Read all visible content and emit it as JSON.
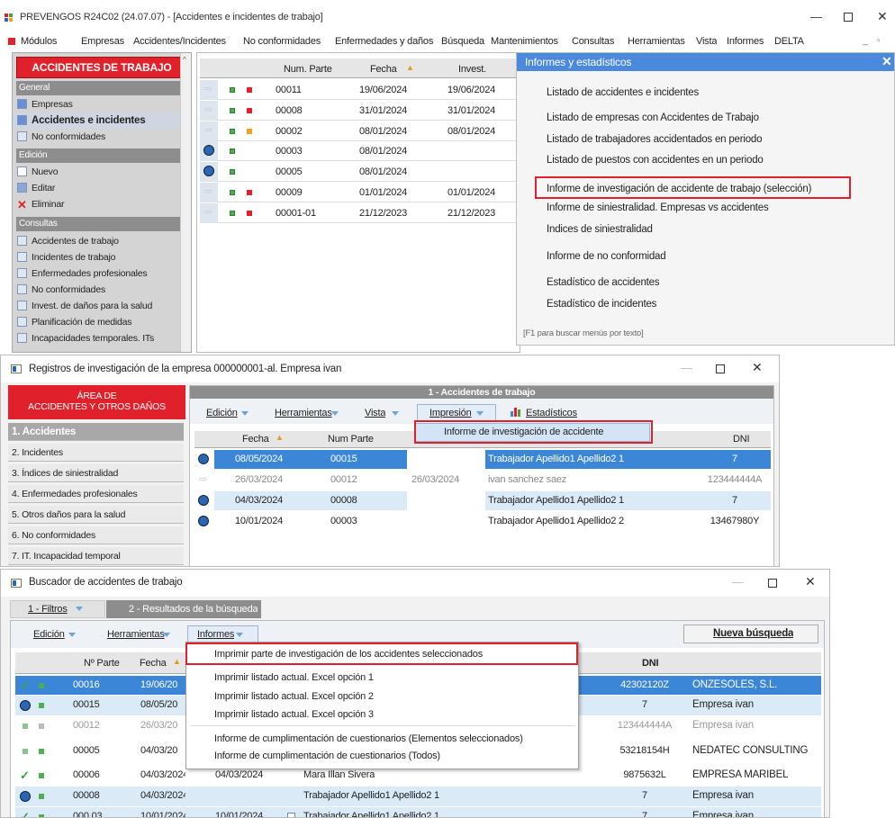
{
  "win1": {
    "title": "PREVENGOS R24C02 (24.07.07) - [Accidentes e incidentes de trabajo]",
    "menu": [
      "Módulos",
      "Empresas",
      "Accidentes/Incidentes",
      "No conformidades",
      "Enfermedades y daños",
      "Búsqueda",
      "Mantenimientos",
      "Consultas",
      "Herramientas",
      "Vista",
      "Informes",
      "DELTA"
    ],
    "sidebar": {
      "header": "ACCIDENTES DE TRABAJO",
      "g1": "General",
      "g1_items": [
        "Empresas",
        "Accidentes e incidentes",
        "No conformidades"
      ],
      "g2": "Edición",
      "g2_items": [
        "Nuevo",
        "Editar",
        "Eliminar"
      ],
      "g3": "Consultas",
      "g3_items": [
        "Accidentes de trabajo",
        "Incidentes de trabajo",
        "Enfermedades profesionales",
        "No conformidades",
        "Invest. de daños para la salud",
        "Planificación de medidas",
        "Incapacidades temporales. ITs"
      ]
    },
    "grid": {
      "headers": [
        "Num. Parte",
        "Fecha",
        "Invest."
      ],
      "rows": [
        {
          "parte": "00011",
          "fecha": "19/06/2024",
          "invest": "19/06/2024"
        },
        {
          "parte": "00008",
          "fecha": "31/01/2024",
          "invest": "31/01/2024"
        },
        {
          "parte": "00002",
          "fecha": "08/01/2024",
          "invest": "08/01/2024"
        },
        {
          "parte": "00003",
          "fecha": "08/01/2024",
          "invest": ""
        },
        {
          "parte": "00005",
          "fecha": "08/01/2024",
          "invest": ""
        },
        {
          "parte": "00009",
          "fecha": "01/01/2024",
          "invest": "01/01/2024"
        },
        {
          "parte": "00001-01",
          "fecha": "21/12/2023",
          "invest": "21/12/2023"
        }
      ]
    },
    "informes": {
      "title": "Informes y estadísticos",
      "items": [
        "Listado de accidentes e incidentes",
        "Listado de empresas con Accidentes de Trabajo",
        "Listado de trabajadores accidentados en periodo",
        "Listado de puestos con accidentes en un periodo",
        "Informe de investigación de accidente de trabajo (selección)",
        "Informe de siniestralidad. Empresas vs accidentes",
        "Índices de siniestralidad",
        "Informe de no conformidad",
        "Estadístico de accidentes",
        "Estadístico de incidentes"
      ],
      "footer": "[F1 para buscar menús por texto]"
    }
  },
  "win2": {
    "title": "Registros de investigación de la empresa 000000001-al. Empresa ivan",
    "area_line1": "ÁREA DE",
    "area_line2": "ACCIDENTES Y OTROS DAÑOS",
    "nav": [
      "1. Accidentes",
      "2. Incidentes",
      "3. Índices de siniestralidad",
      "4. Enfermedades profesionales",
      "5. Otros daños para la salud",
      "6. No conformidades",
      "7. IT. Incapacidad temporal"
    ],
    "panel_title": "1 - Accidentes de trabajo",
    "toolbar": [
      "Edición",
      "Herramientas",
      "Vista",
      "Impresión",
      "Estadísticos"
    ],
    "popup": "Informe de investigación de accidente",
    "headers": [
      "Fecha",
      "Num Parte",
      "DNI"
    ],
    "rows": [
      {
        "fecha": "08/05/2024",
        "parte": "00015",
        "inv": "",
        "trab": "Trabajador Apellido1 Apellido2 1",
        "dni": "7"
      },
      {
        "fecha": "26/03/2024",
        "parte": "00012",
        "inv": "26/03/2024",
        "trab": "ivan sanchez saez",
        "dni": "123444444A"
      },
      {
        "fecha": "04/03/2024",
        "parte": "00008",
        "inv": "",
        "trab": "Trabajador Apellido1 Apellido2 1",
        "dni": "7"
      },
      {
        "fecha": "10/01/2024",
        "parte": "00003",
        "inv": "",
        "trab": "Trabajador Apellido1 Apellido2 2",
        "dni": "13467980Y"
      }
    ]
  },
  "win3": {
    "title": "Buscador de accidentes de trabajo",
    "tab1": "1 - Filtros",
    "tab2": "2 - Resultados de la búsqueda",
    "toolbar": [
      "Edición",
      "Herramientas",
      "Informes"
    ],
    "nueva": "Nueva búsqueda",
    "headers": [
      "Nº Parte",
      "Fecha",
      "DNI"
    ],
    "menu": [
      "Imprimir parte de investigación de los accidentes seleccionados",
      "Imprimir listado actual. Excel opción 1",
      "Imprimir listado actual. Excel opción 2",
      "Imprimir listado actual. Excel opción 3",
      "Informe de cumplimentación de cuestionarios (Elementos seleccionados)",
      "Informe de cumplimentación de cuestionarios (Todos)"
    ],
    "rows": [
      {
        "parte": "00016",
        "fecha": "19/06/20",
        "fecha2": "",
        "trab": "",
        "dni": "42302120Z",
        "emp": "ONZESOLES, S.L."
      },
      {
        "parte": "00015",
        "fecha": "08/05/20",
        "fecha2": "",
        "trab": "",
        "dni": "7",
        "emp": "Empresa ivan"
      },
      {
        "parte": "00012",
        "fecha": "26/03/20",
        "fecha2": "",
        "trab": "",
        "dni": "123444444A",
        "emp": "Empresa ivan"
      },
      {
        "parte": "00005",
        "fecha": "04/03/20",
        "fecha2": "",
        "trab": "",
        "dni": "53218154H",
        "emp": "NEDATEC CONSULTING"
      },
      {
        "parte": "00006",
        "fecha": "04/03/2024",
        "fecha2": "04/03/2024",
        "trab": "Mara Illan Sivera",
        "dni": "9875632L",
        "emp": "EMPRESA MARIBEL"
      },
      {
        "parte": "00008",
        "fecha": "04/03/2024",
        "fecha2": "",
        "trab": "Trabajador Apellido1 Apellido2 1",
        "dni": "7",
        "emp": "Empresa ivan"
      },
      {
        "parte": "000.03",
        "fecha": "10/01/2024",
        "fecha2": "10/01/2024",
        "trab": "Trabajador Apellido1 Apellido2 1",
        "dni": "7",
        "emp": "Empresa ivan"
      }
    ]
  },
  "colors": {
    "red": "#e0202a",
    "blue": "#4a89dc",
    "select": "#3c86d8",
    "sidebar": "#d4d4d4"
  }
}
